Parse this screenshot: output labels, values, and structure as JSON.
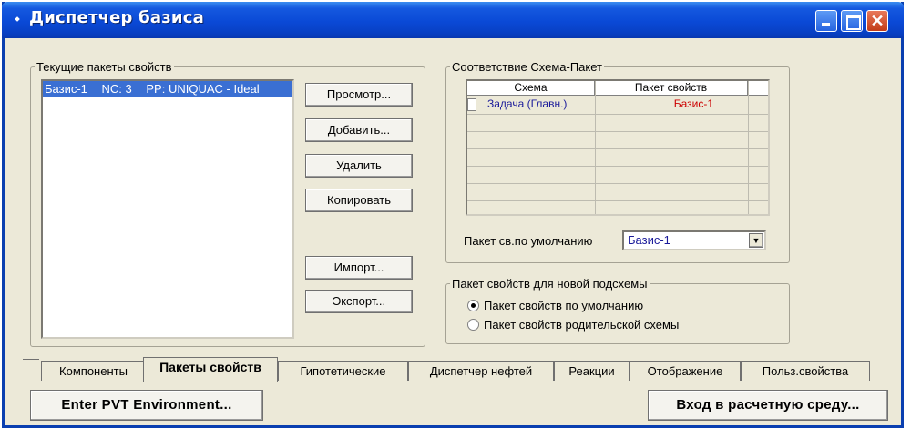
{
  "window": {
    "title": "Диспетчер базиса",
    "title_icon": "app-icon",
    "controls": [
      "minimize-icon",
      "maximize-icon",
      "close-icon"
    ]
  },
  "current_packages": {
    "legend": "Текущие пакеты свойств",
    "items": [
      {
        "name": "Базис-1",
        "nc": "NC: 3",
        "pp": "PP: UNIQUAC - Ideal"
      }
    ],
    "buttons": {
      "view": "Просмотр...",
      "add": "Добавить...",
      "delete": "Удалить",
      "copy": "Копировать",
      "import": "Импорт...",
      "export": "Экспорт..."
    }
  },
  "scheme_package": {
    "legend": "Соответствие Схема-Пакет",
    "columns": [
      "Схема",
      "Пакет свойств"
    ],
    "rows": [
      {
        "scheme": "Задача (Главн.)",
        "package": "Базис-1"
      }
    ],
    "default_label": "Пакет св.по умолчанию",
    "default_value": "Базис-1"
  },
  "new_subflowsheet": {
    "legend": "Пакет свойств для новой подсхемы",
    "options": [
      {
        "label": "Пакет свойств по умолчанию",
        "selected": true
      },
      {
        "label": "Пакет свойств родительской схемы",
        "selected": false
      }
    ]
  },
  "tabs": [
    {
      "label": "Компоненты",
      "active": false
    },
    {
      "label": "Пакеты свойств",
      "active": true
    },
    {
      "label": "Гипотетические",
      "active": false
    },
    {
      "label": "Диспетчер нефтей",
      "active": false
    },
    {
      "label": "Реакции",
      "active": false
    },
    {
      "label": "Отображение",
      "active": false
    },
    {
      "label": "Польз.свойства",
      "active": false
    }
  ],
  "footer": {
    "pvt_button": "Enter PVT Environment...",
    "sim_button": "Вход в расчетную среду..."
  },
  "colors": {
    "titlebar": "#0a49d6",
    "selection": "#3a6fd3",
    "scheme_text": "#1a1a9a",
    "package_text": "#cc0000",
    "face": "#ece9d8"
  }
}
